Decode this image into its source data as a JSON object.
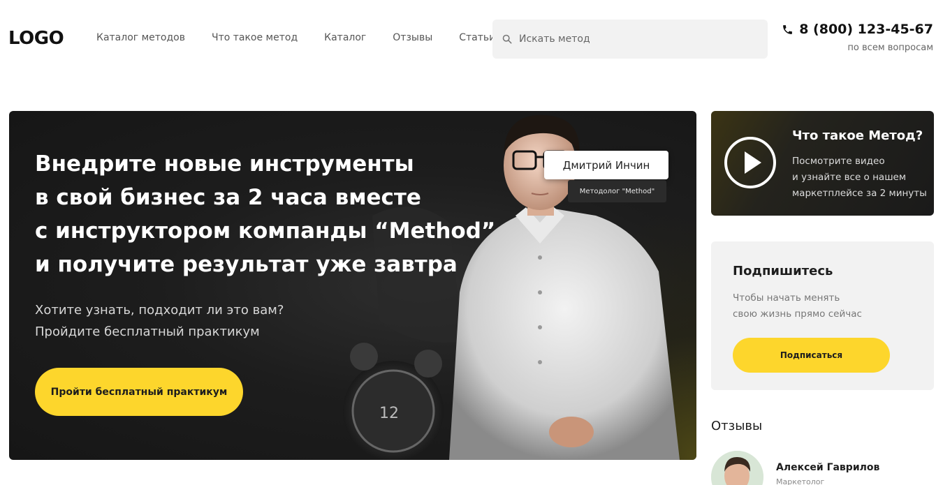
{
  "header": {
    "logo": "LOGO",
    "nav": [
      {
        "label": "Каталог методов"
      },
      {
        "label": "Что такое метод"
      },
      {
        "label": "Каталог"
      },
      {
        "label": "Отзывы"
      },
      {
        "label": "Статьи"
      }
    ],
    "search_placeholder": "Искать метод",
    "phone": "8 (800) 123-45-67",
    "phone_note": "по всем вопросам"
  },
  "hero": {
    "title_lines": [
      "Внедрите новые инструменты",
      "в свой бизнес за 2 часа вместе",
      "с инструктором компанды “Method”",
      "и получите результат уже завтра"
    ],
    "subtitle_lines": [
      "Хотите узнать, подходит ли это вам?",
      "Пройдите бесплатный практикум"
    ],
    "cta_label": "Пройти бесплатный практикум",
    "instructor_name": "Дмитрий Инчин",
    "instructor_role": "Методолог \"Method\""
  },
  "video_card": {
    "title": "Что такое Метод?",
    "desc_lines": [
      "Посмотрите видео",
      "и узнайте все о нашем",
      "маркетплейсе за 2 минуты"
    ]
  },
  "subscribe": {
    "title": "Подпишитесь",
    "desc_lines": [
      "Чтобы начать менять",
      "свою жизнь прямо сейчас"
    ],
    "button_label": "Подписаться"
  },
  "reviews": {
    "title": "Отзывы",
    "items": [
      {
        "name": "Алексей Гаврилов",
        "role": "Маркетолог"
      }
    ]
  },
  "colors": {
    "accent": "#fdd62c",
    "hero_bg": "#1d1d1d",
    "card_bg": "#f2f2f2"
  }
}
